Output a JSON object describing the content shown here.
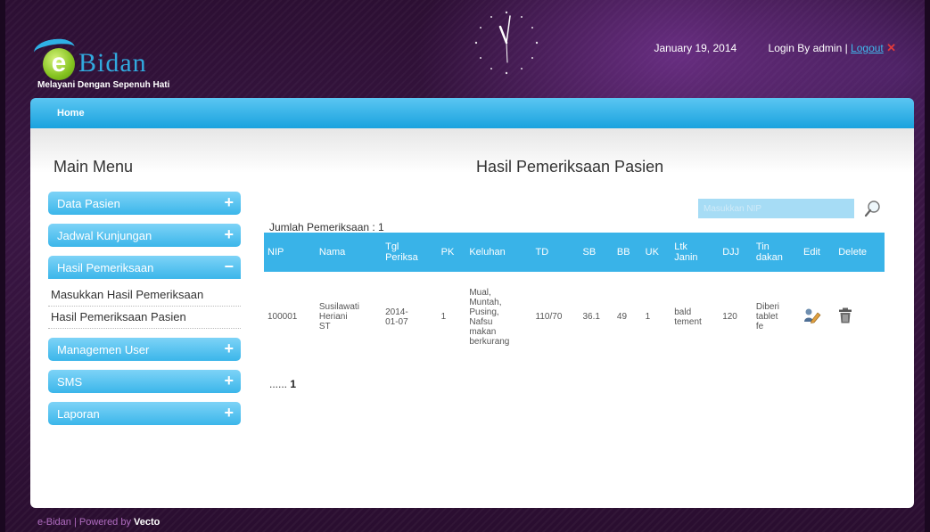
{
  "app": {
    "logo_letter": "e",
    "logo_name": "Bidan",
    "tagline": "Melayani Dengan Sepenuh Hati"
  },
  "header": {
    "date": "January 19, 2014",
    "login_text": "Login By admin |",
    "logout_label": "Logout"
  },
  "nav": {
    "home": "Home"
  },
  "sidebar": {
    "title": "Main Menu",
    "items": [
      {
        "label": "Data Pasien",
        "sign": "+"
      },
      {
        "label": "Jadwal Kunjungan",
        "sign": "+"
      },
      {
        "label": "Hasil Pemeriksaan",
        "sign": "−"
      },
      {
        "label": "Managemen User",
        "sign": "+"
      },
      {
        "label": "SMS",
        "sign": "+"
      },
      {
        "label": "Laporan",
        "sign": "+"
      }
    ],
    "submenu": [
      {
        "label": "Masukkan Hasil Pemeriksaan"
      },
      {
        "label": "Hasil Pemeriksaan Pasien"
      }
    ]
  },
  "main": {
    "title": "Hasil Pemeriksaan Pasien",
    "search_placeholder": "Masukkan NIP",
    "count_text": "Jumlah Pemeriksaan : 1",
    "columns": [
      "NIP",
      "Nama",
      "Tgl\nPeriksa",
      "PK",
      "Keluhan",
      "TD",
      "SB",
      "BB",
      "UK",
      "Ltk\nJanin",
      "DJJ",
      "Tin\ndakan",
      "Edit",
      "Delete"
    ],
    "rows": [
      [
        "100001",
        "Susilawati\nHeriani\nST",
        "2014-\n01-07",
        "1",
        "Mual,\nMuntah,\nPusing,\nNafsu\nmakan\nberkurang",
        "110/70",
        "36.1",
        "49",
        "1",
        "bald\ntement",
        "120",
        "Diberi\ntablet\nfe",
        "edit-icon",
        "trash-icon"
      ]
    ],
    "pager_prefix": "......",
    "current_page": "1"
  },
  "footer": {
    "text": "e-Bidan | Powered by",
    "brand": "Vecto"
  },
  "colors": {
    "accent": "#39b3e8",
    "header_bg": "#2c0f33",
    "logout_x": "#e23b3b"
  }
}
